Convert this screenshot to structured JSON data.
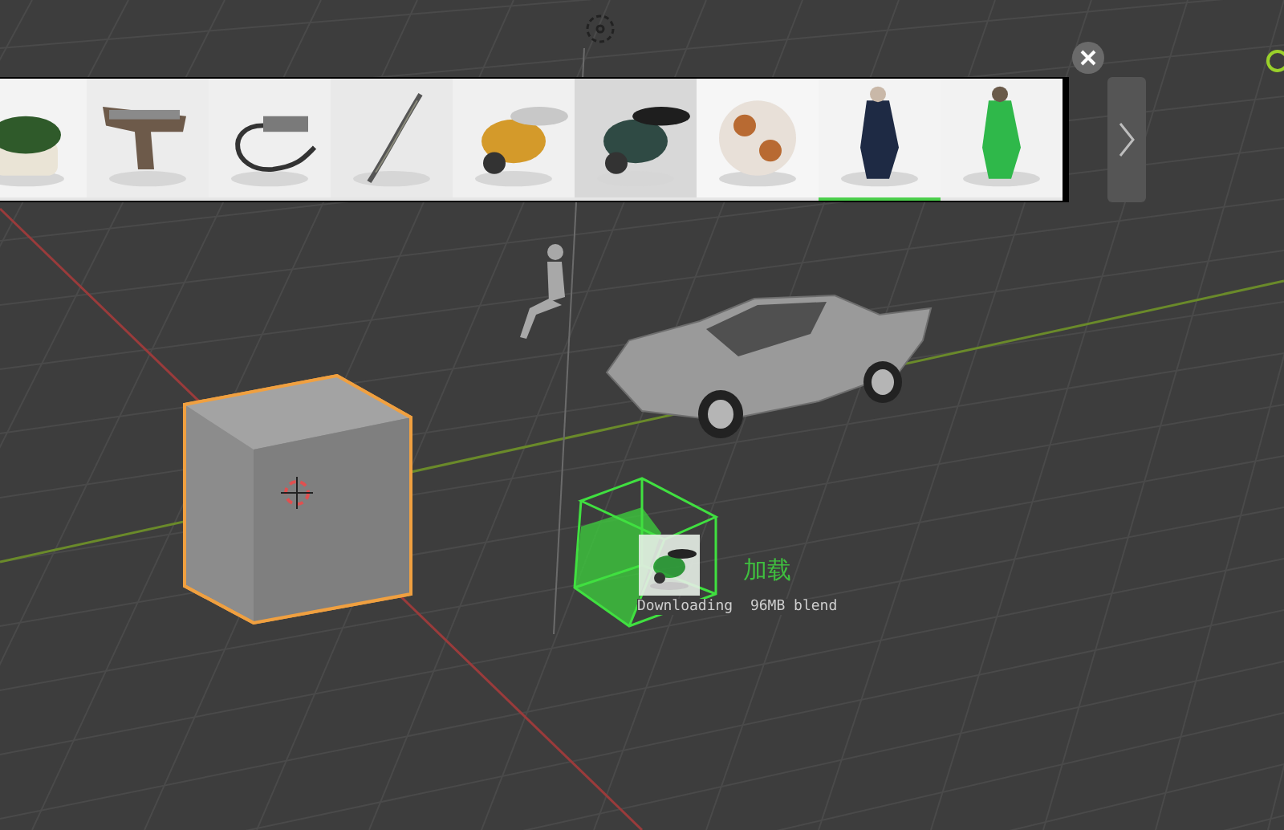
{
  "asset_bar": {
    "thumbnails": [
      {
        "kind": "picture",
        "downloading": false
      },
      {
        "kind": "picture",
        "downloading": false
      },
      {
        "kind": "picture",
        "downloading": false
      },
      {
        "kind": "picture",
        "downloading": false
      },
      {
        "kind": "picture",
        "downloading": false
      },
      {
        "kind": "picture",
        "downloading": false
      },
      {
        "kind": "picture",
        "downloading": false
      },
      {
        "kind": "picture",
        "downloading": true
      },
      {
        "kind": "picture",
        "downloading": false
      }
    ]
  },
  "download": {
    "label": "加载",
    "status": "Downloading  96MB blend"
  }
}
